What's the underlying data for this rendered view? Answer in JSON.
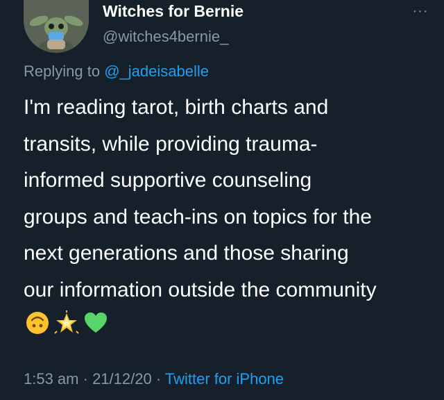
{
  "tweet": {
    "display_name": "Witches for Bernie",
    "handle": "@witches4bernie_",
    "more_icon": "···",
    "replying_prefix": "Replying to ",
    "replying_mention": "@_jadeisabelle",
    "text_lines": [
      "I'm reading tarot, birth charts and",
      "transits, while providing trauma-",
      "informed supportive counseling",
      "groups and teach-ins on topics for the",
      "next generations and those sharing",
      "our information outside the community"
    ],
    "emojis": [
      "upside-down-face-icon",
      "glowing-star-icon",
      "green-heart-icon"
    ],
    "time": "1:53 am",
    "separator": " · ",
    "date": "21/12/20",
    "source": "Twitter for iPhone"
  },
  "colors": {
    "background": "#15202b",
    "text": "#ffffff",
    "secondary": "#8899a6",
    "link": "#1da1f2"
  }
}
